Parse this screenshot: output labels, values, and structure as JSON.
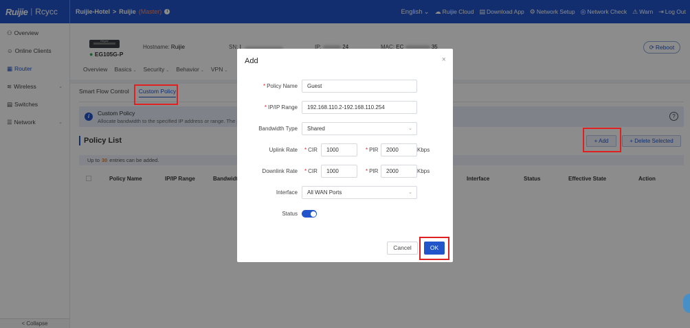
{
  "header": {
    "logo_ruijie": "Ruijie",
    "logo_sep": "|",
    "logo_reyee": "Rcycc",
    "crumb_project": "Ruijie-Hotel",
    "crumb_sep": ">",
    "crumb_device": "Ruijie",
    "crumb_role": "(Master)",
    "info_icon": "i",
    "nav": {
      "language": "English",
      "language_caret": "⌄",
      "cloud": "Ruijie Cloud",
      "download": "Download App",
      "network_setup": "Network Setup",
      "network_check": "Network Check",
      "warn": "Warn",
      "logout": "Log Out"
    },
    "icons": {
      "cloud": "☁",
      "download": "▤",
      "setup": "⚙",
      "check": "◎",
      "warn": "⚠",
      "logout": "⇥"
    }
  },
  "sidebar": {
    "items": [
      {
        "label": "Overview",
        "icon": "⚇"
      },
      {
        "label": "Online Clients",
        "icon": "☺"
      },
      {
        "label": "Router",
        "icon": "▦"
      },
      {
        "label": "Wireless",
        "icon": "≋"
      },
      {
        "label": "Switches",
        "icon": "▤"
      },
      {
        "label": "Network",
        "icon": "☰"
      }
    ],
    "chevron": "⌄",
    "collapse": "Collapse",
    "collapse_icon": "<"
  },
  "device": {
    "model": "EG105G-P",
    "status_dot": "●",
    "image_label": "Reyee",
    "hostname_label": "Hostname:",
    "hostname_value": "Ruijie",
    "sn_label": "SN:",
    "sn_value": "I",
    "ip_label": "IP:",
    "ip_value": "24",
    "mac_label": "MAC:",
    "mac_value": "EC",
    "mac_tail": "35",
    "reboot": "Reboot",
    "reboot_icon": "⟳"
  },
  "subnav": [
    "Overview",
    "Basics",
    "Security",
    "Behavior",
    "VPN"
  ],
  "subnav_caret": "⌄",
  "tabs": {
    "smart_flow": "Smart Flow Control",
    "custom_policy": "Custom Policy"
  },
  "notice": {
    "title": "Custom Policy",
    "text": "Allocate bandwidth to the specified IP address or range. The p",
    "icon": "i",
    "help": "?"
  },
  "policy_list": {
    "title": "Policy List",
    "add": "+ Add",
    "delete": "+ Delete Selected",
    "limit_prefix": "Up to",
    "limit_num": "30",
    "limit_suffix": "entries can be added.",
    "columns": [
      "Policy Name",
      "IP/IP Range",
      "Bandwidt",
      "Interface",
      "Status",
      "Effective State",
      "Action"
    ]
  },
  "modal": {
    "title": "Add",
    "close": "×",
    "policy_name_label": "Policy Name",
    "policy_name_value": "Guest",
    "ip_range_label": "IP/IP Range",
    "ip_range_value": "192.168.110.2-192.168.110.254",
    "bandwidth_type_label": "Bandwidth Type",
    "bandwidth_type_value": "Shared",
    "uplink_label": "Uplink Rate",
    "downlink_label": "Downlink Rate",
    "cir_label": "CIR",
    "pir_label": "PIR",
    "uplink_cir": "1000",
    "uplink_pir": "2000",
    "downlink_cir": "1000",
    "downlink_pir": "2000",
    "unit": "Kbps",
    "interface_label": "Interface",
    "interface_value": "All WAN Ports",
    "status_label": "Status",
    "status_on": true,
    "required_mark": "*",
    "select_caret": "⌄",
    "cancel": "Cancel",
    "ok": "OK"
  },
  "colors": {
    "primary": "#2155c9",
    "highlight": "#e02020",
    "master": "#ff8b5c",
    "limit_num": "#f07c1c"
  }
}
